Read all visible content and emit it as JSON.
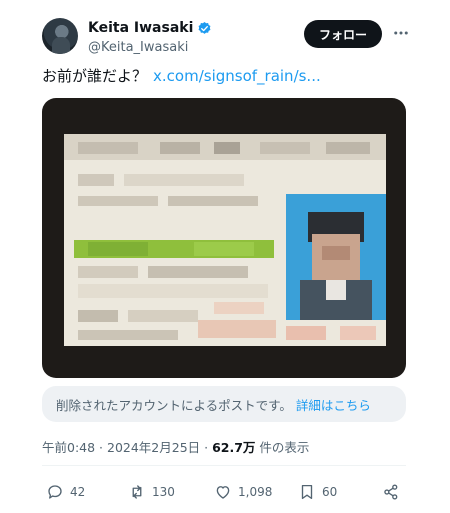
{
  "author": {
    "display_name": "Keita Iwasaki",
    "handle": "@Keita_Iwasaki",
    "verified": true
  },
  "follow_label": "フォロー",
  "tweet": {
    "text": "お前が誰だよ？",
    "link": "x.com/signsof_rain/s..."
  },
  "notice": {
    "text": "削除されたアカウントによるポストです。",
    "link": "詳細はこちら"
  },
  "meta": {
    "timestamp": "午前0:48 · 2024年2月25日 ·",
    "views": "62.7万",
    "views_suffix": "件の表示"
  },
  "actions": {
    "replies": "42",
    "reposts": "130",
    "likes": "1,098",
    "bookmarks": "60"
  },
  "icons": {
    "verified": "verified-badge-icon",
    "more": "more-icon",
    "reply": "reply-icon",
    "repost": "repost-icon",
    "like": "heart-icon",
    "bookmark": "bookmark-icon",
    "share": "share-icon"
  },
  "colors": {
    "accent": "#1d9bf0",
    "text": "#0f1419",
    "muted": "#536471"
  }
}
